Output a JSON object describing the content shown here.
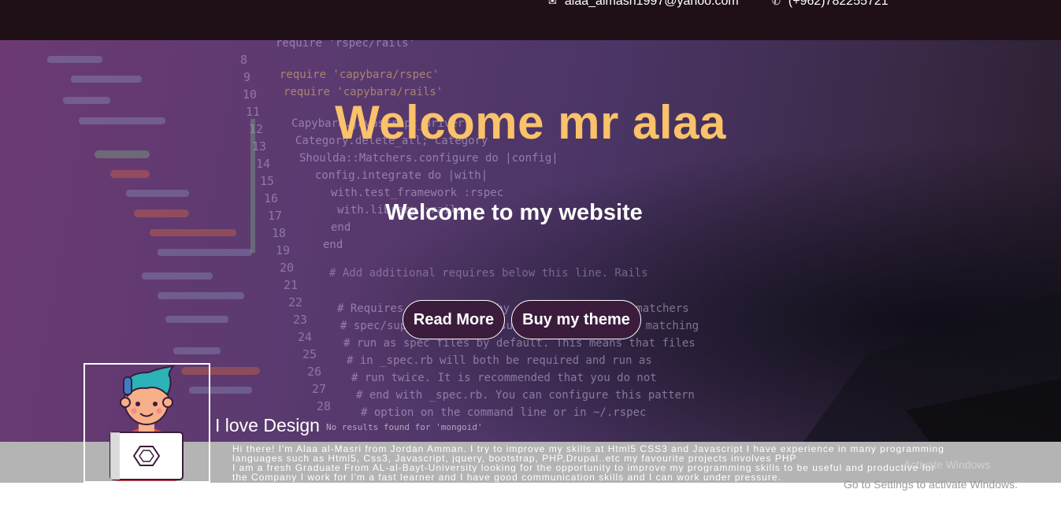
{
  "topbar": {
    "email": "alaa_almasri1997@yahoo.com",
    "phone": "(+962)782255721",
    "email_icon": "envelope-icon",
    "phone_icon": "phone-icon"
  },
  "hero": {
    "title": "Welcome mr alaa",
    "subtitle": "Welcome to my website",
    "read_more_label": "Read More",
    "buy_theme_label": "Buy my theme",
    "title_color": "#f9c26b",
    "background_color": "#4b3565"
  },
  "about": {
    "avatar_icon": "developer-avatar-icon",
    "tagline": "I love Design",
    "lines": [
      "Hi there! I'm Alaa al-Masri from Jordan Amman. I try to improve my skills at Html5 CSS3 and Javascript I have experience in many programming",
      "languages such as Html5, Css3, Javascript, jquery, bootstrap, PHP,Drupal..etc my favourite projects involves PHP",
      "I am a fresh Graduate From AL-al-Bayt-University looking for the opportunity to improve my programming skills to be useful and productive for",
      "the Company I work for I'm a fast learner and I have good communication skills and I can work under pressure."
    ]
  },
  "os_notice": {
    "title": "Activate Windows",
    "message": "Go to Settings to activate Windows."
  }
}
